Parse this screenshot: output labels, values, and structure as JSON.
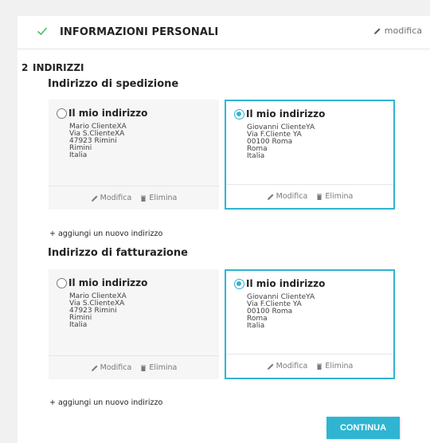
{
  "step_done": {
    "title": "INFORMAZIONI PERSONALI",
    "edit_label": "modifica"
  },
  "step_current": {
    "number": "2",
    "title": "INDIRIZZI"
  },
  "shipping": {
    "section_title": "Indirizzo di spedizione",
    "add_label": "+ aggiungi un nuovo indirizzo",
    "cards": [
      {
        "alias": "Il mio indirizzo",
        "selected": false,
        "lines": [
          "Mario ClienteXA",
          "Via S.ClienteXA",
          "47923 Rimini",
          "Rimini",
          "Italia"
        ],
        "edit": "Modifica",
        "delete": "Elimina"
      },
      {
        "alias": "Il mio indirizzo",
        "selected": true,
        "lines": [
          "Giovanni ClienteYA",
          "Via F.Cliente YA",
          "00100 Roma",
          "Roma",
          "Italia"
        ],
        "edit": "Modifica",
        "delete": "Elimina"
      }
    ]
  },
  "billing": {
    "section_title": "Indirizzo di fatturazione",
    "add_label": "+ aggiungi un nuovo indirizzo",
    "cards": [
      {
        "alias": "Il mio indirizzo",
        "selected": false,
        "lines": [
          "Mario ClienteXA",
          "Via S.ClienteXA",
          "47923 Rimini",
          "Rimini",
          "Italia"
        ],
        "edit": "Modifica",
        "delete": "Elimina"
      },
      {
        "alias": "Il mio indirizzo",
        "selected": true,
        "lines": [
          "Giovanni ClienteYA",
          "Via F.Cliente YA",
          "00100 Roma",
          "Roma",
          "Italia"
        ],
        "edit": "Modifica",
        "delete": "Elimina"
      }
    ]
  },
  "continue_label": "CONTINUA",
  "colors": {
    "accent": "#2fb5d2",
    "check": "#4cbb6c",
    "card_bg": "#f6f6f6"
  }
}
